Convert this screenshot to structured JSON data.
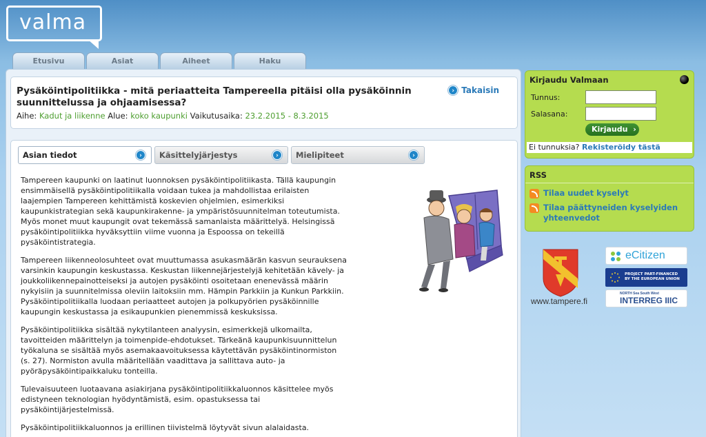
{
  "logo": {
    "text": "valma"
  },
  "tabs": [
    {
      "label": "Etusivu"
    },
    {
      "label": "Asiat"
    },
    {
      "label": "Aiheet"
    },
    {
      "label": "Haku"
    }
  ],
  "issue": {
    "title": "Pysäköintipolitiikka - mitä periaatteita Tampereella pitäisi olla pysäköinnin suunnittelussa ja ohjaamisessa?",
    "topic_label": "Aihe:",
    "topic_value": "Kadut ja liikenne",
    "area_label": "Alue:",
    "area_value": "koko kaupunki",
    "period_label": "Vaikutusaika:",
    "period_value": "23.2.2015 - 8.3.2015",
    "back_label": "Takaisin"
  },
  "subtabs": [
    {
      "label": "Asian tiedot",
      "active": true
    },
    {
      "label": "Käsittelyjärjestys",
      "active": false
    },
    {
      "label": "Mielipiteet",
      "active": false
    }
  ],
  "article": {
    "paragraphs": [
      "Tampereen kaupunki on laatinut luonnoksen pysäköintipolitiikasta. Tällä kaupungin ensimmäisellä pysäköintipolitiikalla voidaan tukea ja mahdollistaa erilaisten laajempien Tampereen kehittämistä koskevien ohjelmien, esimerkiksi kaupunkistrategian sekä kaupunkirakenne- ja ympäristösuunnitelman toteutumista. Myös monet muut kaupungit ovat tekemässä samanlaista määrittelyä. Helsingissä pysäköintipolitiikka hyväksyttiin viime vuonna ja Espoossa on tekeillä pysäköintistrategia.",
      "Tampereen liikenneolosuhteet ovat muuttumassa asukasmäärän kasvun seurauksena varsinkin kaupungin keskustassa. Keskustan liikennejärjestelyjä kehitetään kävely- ja joukkoliikennepainotteiseksi ja autojen pysäköinti osoitetaan enenevässä määrin nykyisiin ja suunnitelmissa oleviin laitoksiin mm. Hämpin Parkkiin ja Kunkun Parkkiin. Pysäköintipolitiikalla luodaan periaatteet autojen ja polkupyörien pysäköinnille kaupungin keskustassa ja esikaupunkien pienemmissä keskuksissa.",
      "Pysäköintipolitiikka sisältää nykytilanteen analyysin, esimerkkejä ulkomailta, tavoitteiden määrittelyn ja toimenpide-ehdotukset. Tärkeänä kaupunkisuunnittelun työkaluna se sisältää myös asemakaavoituksessa käytettävän pysäköintinormiston (s. 27). Normiston avulla määritellään vaadittava ja sallittava auto- ja pyöräpysäköintipaikkaluku tonteilla.",
      "Tulevaisuuteen luotaavana asiakirjana pysäköintipolitiikkaluonnos käsittelee myös edistyneen teknologian hyödyntämistä, esim. opastuksessa tai pysäköintijärjestelmissä.",
      "Pysäköintipolitiikkaluonnos ja erillinen tiivistelmä löytyvät sivun alalaidasta."
    ]
  },
  "login": {
    "title": "Kirjaudu Valmaan",
    "username_label": "Tunnus:",
    "password_label": "Salasana:",
    "button_label": "Kirjaudu",
    "no_account_text": "Ei tunnuksia?",
    "register_link": "Rekisteröidy tästä"
  },
  "rss": {
    "title": "RSS",
    "items": [
      {
        "label": "Tilaa uudet kyselyt"
      },
      {
        "label": "Tilaa päättyneiden kyselyiden yhteenvedot"
      }
    ]
  },
  "partners": {
    "tampere_url_text": "www.tampere.fi",
    "ecitizen_text": "eCitizen",
    "eu_line1": "PROJECT PART-FINANCED",
    "eu_line2": "BY THE EUROPEAN UNION",
    "interreg_small1": "NORTH Sea South West",
    "interreg_text": "INTERREG IIIC"
  },
  "colors": {
    "sidebar_green": "#b5dc4f",
    "link_blue": "#2b7ab8",
    "meta_green": "#4d9e2f",
    "button_green": "#3f9234"
  }
}
